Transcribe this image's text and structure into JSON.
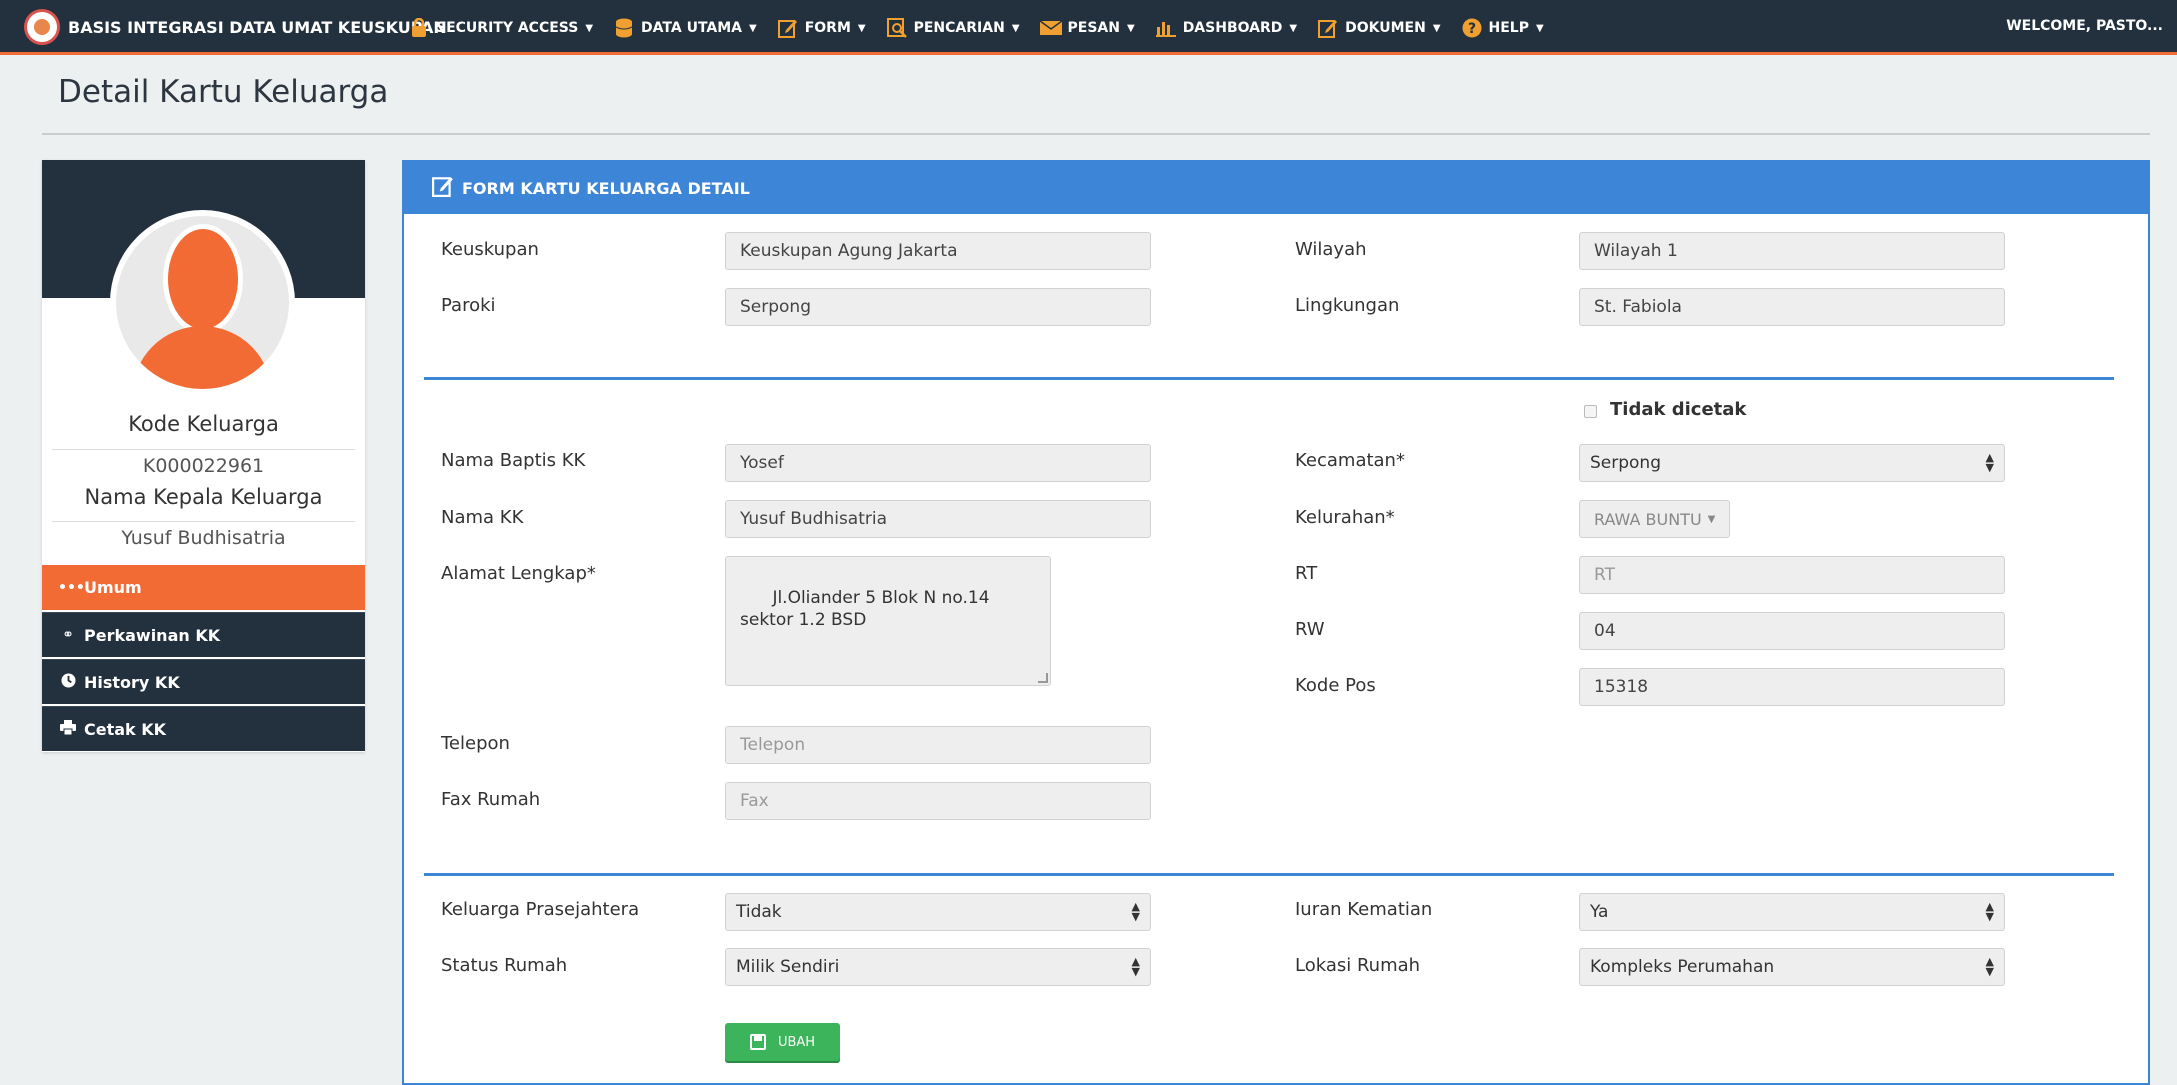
{
  "navbar": {
    "brand": "BASIS INTEGRASI DATA UMAT KEUSKUPAN",
    "menu": [
      {
        "label": "SECURITY ACCESS",
        "icon": "lock-icon"
      },
      {
        "label": "DATA UTAMA",
        "icon": "database-icon"
      },
      {
        "label": "FORM",
        "icon": "edit-icon"
      },
      {
        "label": "PENCARIAN",
        "icon": "search-icon"
      },
      {
        "label": "PESAN",
        "icon": "envelope-icon"
      },
      {
        "label": "DASHBOARD",
        "icon": "bar-chart-icon"
      },
      {
        "label": "DOKUMEN",
        "icon": "edit-icon"
      },
      {
        "label": "HELP",
        "icon": "question-icon"
      }
    ],
    "welcome": "WELCOME, PASTO..."
  },
  "page": {
    "title": "Detail Kartu Keluarga"
  },
  "profile": {
    "kode_label": "Kode Keluarga",
    "kode_value": "K000022961",
    "nama_label": "Nama Kepala Keluarga",
    "nama_value": "Yusuf Budhisatria",
    "menu": [
      {
        "label": "Umum",
        "icon": "ellipsis-icon",
        "active": true
      },
      {
        "label": "Perkawinan KK",
        "icon": "rings-icon",
        "active": false
      },
      {
        "label": "History KK",
        "icon": "clock-icon",
        "active": false
      },
      {
        "label": "Cetak KK",
        "icon": "print-icon",
        "active": false
      }
    ]
  },
  "form": {
    "header": "FORM KARTU KELUARGA DETAIL",
    "keuskupan": {
      "label": "Keuskupan",
      "value": "Keuskupan Agung Jakarta"
    },
    "paroki": {
      "label": "Paroki",
      "value": "Serpong"
    },
    "wilayah": {
      "label": "Wilayah",
      "value": "Wilayah 1"
    },
    "lingkungan": {
      "label": "Lingkungan",
      "value": "St. Fabiola"
    },
    "tidak_dicetak": {
      "label": "Tidak dicetak",
      "checked": false
    },
    "nama_baptis": {
      "label": "Nama Baptis KK",
      "value": "Yosef"
    },
    "nama_kk": {
      "label": "Nama KK",
      "value": "Yusuf Budhisatria"
    },
    "alamat": {
      "label": "Alamat Lengkap*",
      "value": "Jl.Oliander 5 Blok N no.14 sektor 1.2 BSD"
    },
    "telepon": {
      "label": "Telepon",
      "placeholder": "Telepon"
    },
    "fax": {
      "label": "Fax Rumah",
      "placeholder": "Fax"
    },
    "kecamatan": {
      "label": "Kecamatan*",
      "value": "Serpong"
    },
    "kelurahan": {
      "label": "Kelurahan*",
      "value": "RAWA BUNTU"
    },
    "rt": {
      "label": "RT",
      "placeholder": "RT"
    },
    "rw": {
      "label": "RW",
      "value": "04"
    },
    "kode_pos": {
      "label": "Kode Pos",
      "value": "15318"
    },
    "prasejahtera": {
      "label": "Keluarga Prasejahtera",
      "value": "Tidak"
    },
    "status_rumah": {
      "label": "Status Rumah",
      "value": "Milik Sendiri"
    },
    "iuran": {
      "label": "Iuran Kematian",
      "value": "Ya"
    },
    "lokasi": {
      "label": "Lokasi Rumah",
      "value": "Kompleks Perumahan"
    },
    "submit": "UBAH"
  }
}
